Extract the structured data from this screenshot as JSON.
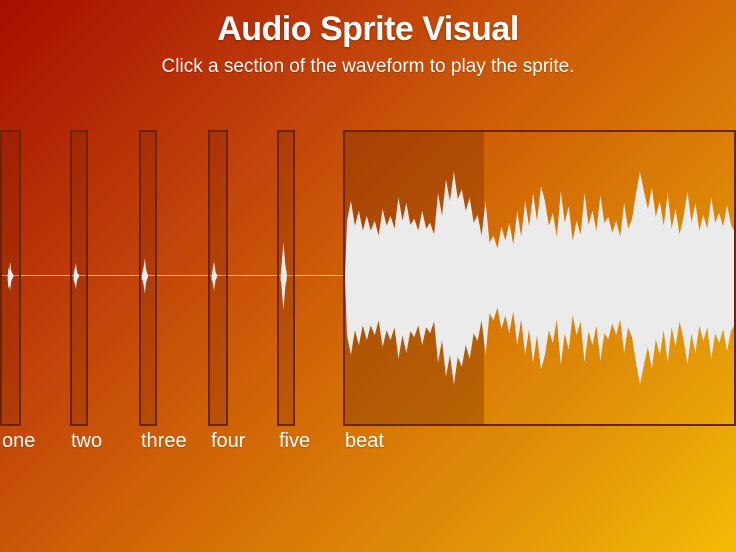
{
  "header": {
    "title": "Audio Sprite Visual",
    "subtitle": "Click a section of the waveform to play the sprite."
  },
  "sprites": [
    {
      "label": "one"
    },
    {
      "label": "two"
    },
    {
      "label": "three"
    },
    {
      "label": "four"
    },
    {
      "label": "five"
    },
    {
      "label": "beat"
    }
  ],
  "colors": {
    "waveform": "#ebebeb",
    "sprite_border": "#6b2407",
    "background_start": "#a60f00",
    "background_end": "#f3bb05"
  }
}
